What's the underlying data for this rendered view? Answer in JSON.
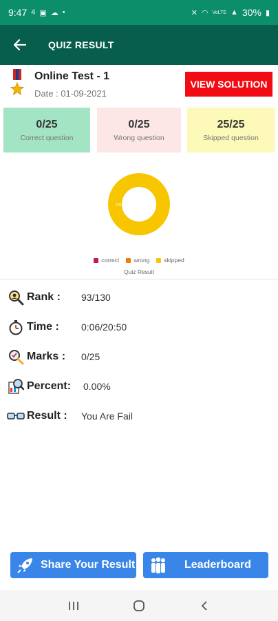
{
  "status_bar": {
    "time": "9:47",
    "data_indicator": "4",
    "battery": "30%",
    "network": "VoLTE"
  },
  "app_bar": {
    "title": "QUIZ RESULT"
  },
  "test": {
    "name": "Online Test - 1",
    "date": "Date : 01-09-2021"
  },
  "view_solution_label": "VIEW SOLUTION",
  "scores": {
    "correct": {
      "value": "0/25",
      "label": "Correct question"
    },
    "wrong": {
      "value": "0/25",
      "label": "Wrong question"
    },
    "skipped": {
      "value": "25/25",
      "label": "Skipped question"
    }
  },
  "chart_data": {
    "type": "pie",
    "title": "Quiz Result",
    "categories": [
      "correct",
      "wrong",
      "skipped"
    ],
    "values": [
      0,
      0,
      25
    ],
    "colors": [
      "#c2185b",
      "#f57c00",
      "#f7c600"
    ],
    "center_label": "100.0%",
    "legend": "bottom"
  },
  "stats": {
    "rank": {
      "label": "Rank :",
      "value": "93/130"
    },
    "time": {
      "label": "Time :",
      "value": "0:06/20:50"
    },
    "marks": {
      "label": "Marks :",
      "value": "0/25"
    },
    "percent": {
      "label": "Percent:",
      "value": "0.00%"
    },
    "result": {
      "label": "Result :",
      "value": "You Are Fail"
    }
  },
  "buttons": {
    "share": "Share Your Result",
    "leaderboard": "Leaderboard"
  },
  "colors": {
    "status_bar": "#0b8e69",
    "app_bar": "#075e4d",
    "accent_red": "#f30b13",
    "button_blue": "#3a86e8"
  }
}
